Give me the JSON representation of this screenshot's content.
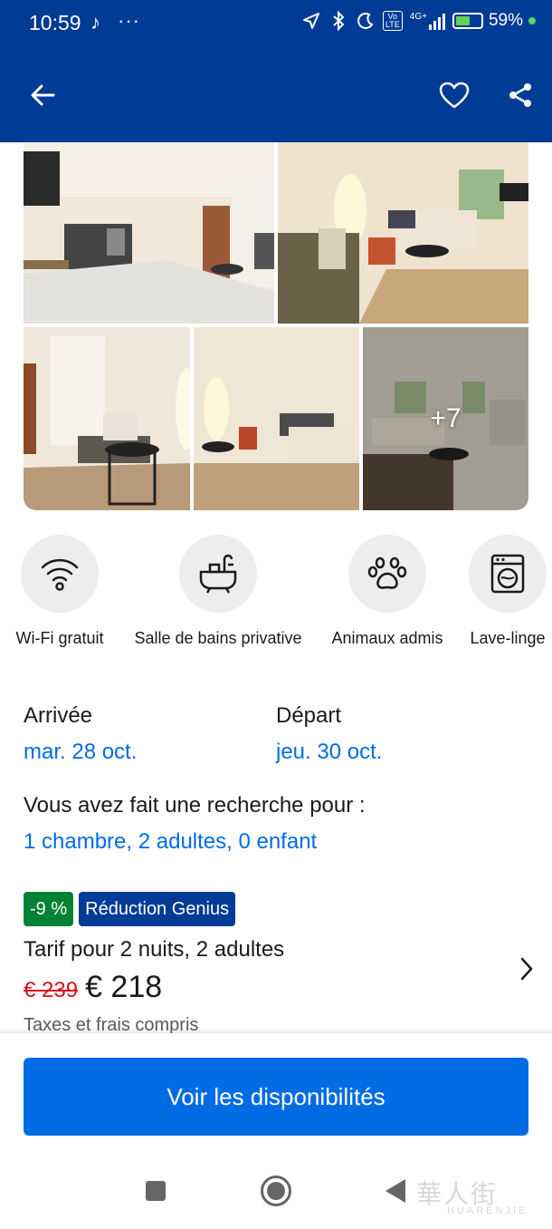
{
  "status_bar": {
    "time": "10:59",
    "tiktok_icon": "♪",
    "more": "···",
    "volte": "Vo LTE",
    "network": "4G+",
    "battery_percent_label": "59%",
    "battery_level": 0.59
  },
  "gallery": {
    "more_photos_label": "+7"
  },
  "amenities": [
    {
      "label": "Wi-Fi gratuit",
      "icon": "wifi-icon"
    },
    {
      "label": "Salle de bains privative",
      "icon": "bathtub-icon"
    },
    {
      "label": "Animaux admis",
      "icon": "paw-icon"
    },
    {
      "label": "Lave-linge",
      "icon": "washing-machine-icon"
    }
  ],
  "dates": {
    "checkin_title": "Arrivée",
    "checkin_value": "mar. 28 oct.",
    "checkout_title": "Départ",
    "checkout_value": "jeu. 30 oct."
  },
  "search": {
    "title": "Vous avez fait une recherche pour :",
    "value": "1 chambre, 2 adultes, 0 enfant"
  },
  "price": {
    "discount_badge": "-9 %",
    "genius_badge": "Réduction Genius",
    "caption": "Tarif pour 2 nuits, 2 adultes",
    "old_price": "€ 239",
    "new_price": "€ 218",
    "taxes": "Taxes et frais compris"
  },
  "cta": {
    "label": "Voir les disponibilités"
  },
  "watermark": {
    "cn": "華人街",
    "en": "HUARENJIE"
  },
  "colors": {
    "header": "#003b95",
    "link": "#006ce4",
    "discount": "#008234",
    "old_price": "#d4111e"
  }
}
